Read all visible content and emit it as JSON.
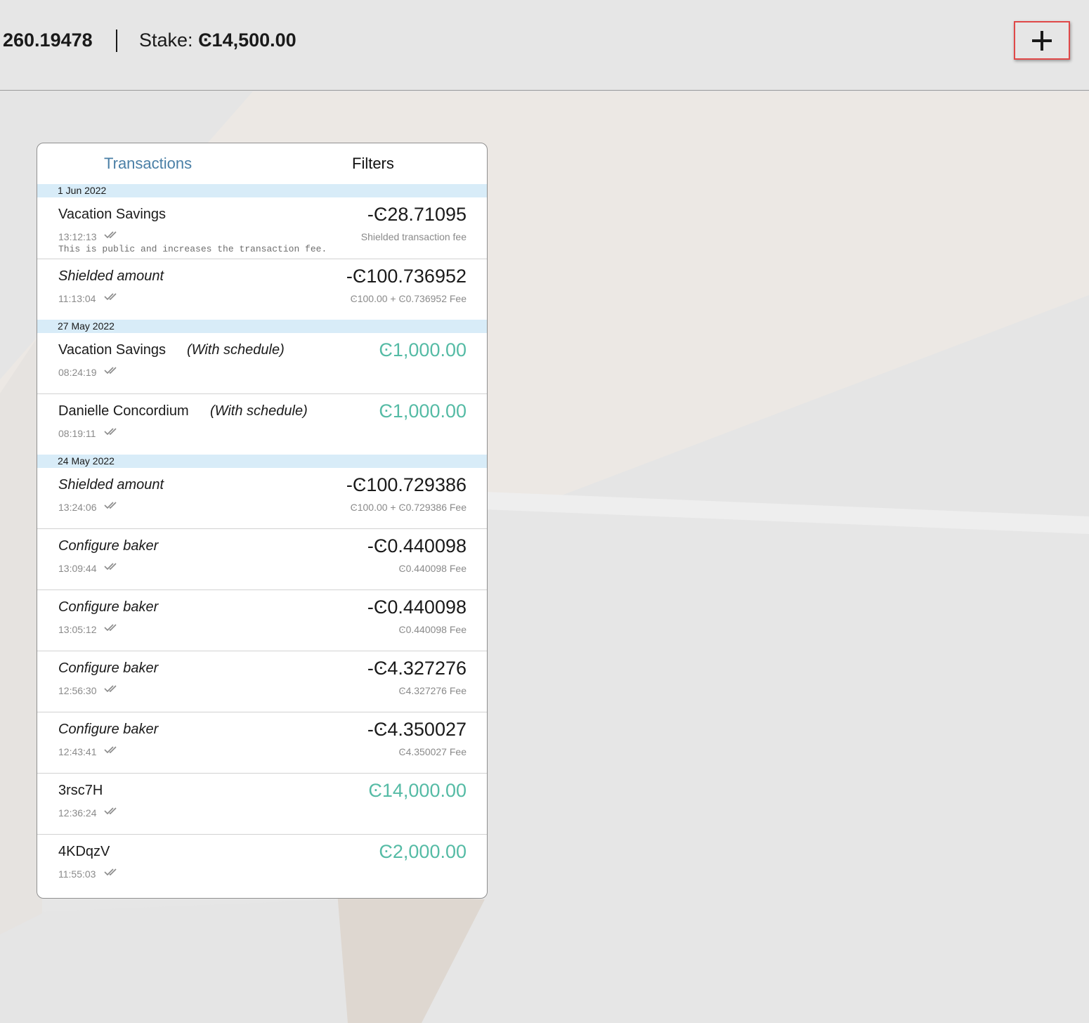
{
  "header": {
    "balance": "260.19478",
    "stake_label": "Stake:",
    "stake_value": "Ͼ14,500.00",
    "add_icon": "plus-icon"
  },
  "tabs": {
    "transactions": "Transactions",
    "filters": "Filters"
  },
  "groups": [
    {
      "date": "1 Jun 2022",
      "items": [
        {
          "title": "Vacation Savings",
          "italic": false,
          "schedule": "",
          "time": "13:12:13",
          "amount": "-Ͼ28.71095",
          "positive": false,
          "sub": "Shielded transaction fee",
          "memo": "This is public and increases the transaction fee."
        },
        {
          "title": "Shielded amount",
          "italic": true,
          "schedule": "",
          "time": "11:13:04",
          "amount": "-Ͼ100.736952",
          "positive": false,
          "sub": "Ͼ100.00 + Ͼ0.736952 Fee",
          "memo": ""
        }
      ]
    },
    {
      "date": "27 May 2022",
      "items": [
        {
          "title": "Vacation Savings",
          "italic": false,
          "schedule": "(With schedule)",
          "time": "08:24:19",
          "amount": "Ͼ1,000.00",
          "positive": true,
          "sub": "",
          "memo": ""
        },
        {
          "title": "Danielle Concordium",
          "italic": false,
          "schedule": "(With schedule)",
          "time": "08:19:11",
          "amount": "Ͼ1,000.00",
          "positive": true,
          "sub": "",
          "memo": ""
        }
      ]
    },
    {
      "date": "24 May 2022",
      "items": [
        {
          "title": "Shielded amount",
          "italic": true,
          "schedule": "",
          "time": "13:24:06",
          "amount": "-Ͼ100.729386",
          "positive": false,
          "sub": "Ͼ100.00 + Ͼ0.729386 Fee",
          "memo": ""
        },
        {
          "title": "Configure baker",
          "italic": true,
          "schedule": "",
          "time": "13:09:44",
          "amount": "-Ͼ0.440098",
          "positive": false,
          "sub": "Ͼ0.440098 Fee",
          "memo": ""
        },
        {
          "title": "Configure baker",
          "italic": true,
          "schedule": "",
          "time": "13:05:12",
          "amount": "-Ͼ0.440098",
          "positive": false,
          "sub": "Ͼ0.440098 Fee",
          "memo": ""
        },
        {
          "title": "Configure baker",
          "italic": true,
          "schedule": "",
          "time": "12:56:30",
          "amount": "-Ͼ4.327276",
          "positive": false,
          "sub": "Ͼ4.327276 Fee",
          "memo": ""
        },
        {
          "title": "Configure baker",
          "italic": true,
          "schedule": "",
          "time": "12:43:41",
          "amount": "-Ͼ4.350027",
          "positive": false,
          "sub": "Ͼ4.350027 Fee",
          "memo": ""
        },
        {
          "title": "3rsc7H",
          "italic": false,
          "schedule": "",
          "time": "12:36:24",
          "amount": "Ͼ14,000.00",
          "positive": true,
          "sub": "",
          "memo": ""
        },
        {
          "title": "4KDqzV",
          "italic": false,
          "schedule": "",
          "time": "11:55:03",
          "amount": "Ͼ2,000.00",
          "positive": true,
          "sub": "",
          "memo": ""
        }
      ]
    }
  ],
  "colors": {
    "accent_tab": "#4a7fa6",
    "positive_amount": "#55bba5",
    "date_band": "#d8ecf8",
    "highlight_box": "#e04848"
  }
}
